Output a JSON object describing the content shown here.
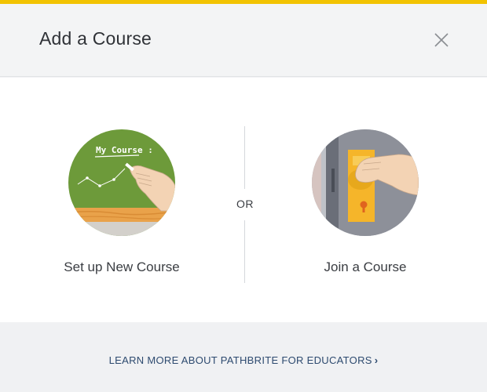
{
  "header": {
    "title": "Add a Course",
    "close_icon": "close-icon"
  },
  "options": {
    "new_course": {
      "label": "Set up New Course",
      "icon": "chalkboard-illustration"
    },
    "separator": "OR",
    "join_course": {
      "label": "Join a Course",
      "icon": "door-handle-illustration"
    }
  },
  "chalkboard_text": "My Course :",
  "footer": {
    "link_label": "LEARN MORE ABOUT PATHBRITE FOR EDUCATORS",
    "chevron": "›"
  },
  "colors": {
    "accent": "#f2c300",
    "chalkboard": "#6d9a3a",
    "link": "#2d4a6f"
  }
}
